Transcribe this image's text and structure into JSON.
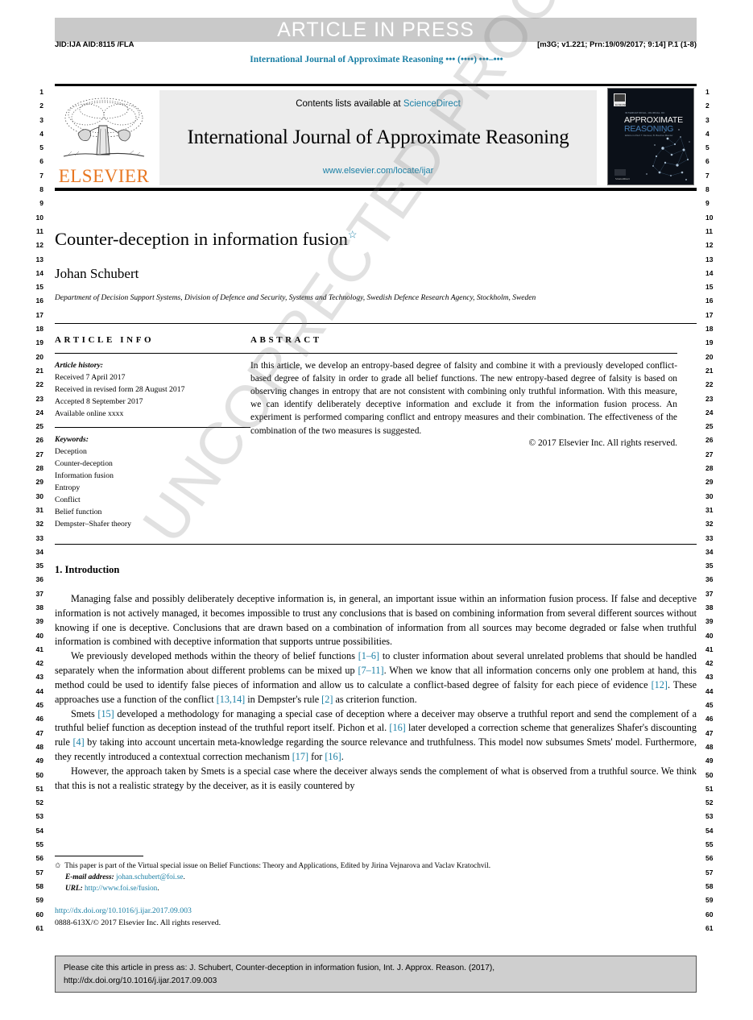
{
  "banner": {
    "label": "ARTICLE IN PRESS"
  },
  "jid": {
    "left": "JID:IJA    AID:8115 /FLA",
    "right": "[m3G; v1.221; Prn:19/09/2017; 9:14] P.1 (1-8)"
  },
  "running_title": "International Journal of Approximate Reasoning ••• (••••) •••–•••",
  "masthead": {
    "contents_prefix": "Contents lists available at ",
    "sciencedirect": "ScienceDirect",
    "journal_name": "International Journal of Approximate Reasoning",
    "journal_url": "www.elsevier.com/locate/ijar",
    "publisher": "ELSEVIER",
    "cover_line1": "APPROXIMATE",
    "cover_line2": "REASONING"
  },
  "watermark": {
    "text": "UNCORRECTED PROOF"
  },
  "article": {
    "title": "Counter-deception in information fusion",
    "title_star": "☆",
    "author": "Johan Schubert",
    "affiliation": "Department of Decision Support Systems, Division of Defence and Security, Systems and Technology, Swedish Defence Research Agency, Stockholm, Sweden"
  },
  "info": {
    "heading": "ARTICLE INFO",
    "history_label": "Article history:",
    "history": [
      "Received 7 April 2017",
      "Received in revised form 28 August 2017",
      "Accepted 8 September 2017",
      "Available online xxxx"
    ],
    "keywords_label": "Keywords:",
    "keywords": [
      "Deception",
      "Counter-deception",
      "Information fusion",
      "Entropy",
      "Conflict",
      "Belief function",
      "Dempster–Shafer theory"
    ]
  },
  "abstract": {
    "heading": "ABSTRACT",
    "text": "In this article, we develop an entropy-based degree of falsity and combine it with a previously developed conflict-based degree of falsity in order to grade all belief functions. The new entropy-based degree of falsity is based on observing changes in entropy that are not consistent with combining only truthful information. With this measure, we can identify deliberately deceptive information and exclude it from the information fusion process. An experiment is performed comparing conflict and entropy measures and their combination. The effectiveness of the combination of the two measures is suggested.",
    "copyright": "© 2017 Elsevier Inc. All rights reserved."
  },
  "body": {
    "section_heading": "1. Introduction",
    "paragraph_1": "Managing false and possibly deliberately deceptive information is, in general, an important issue within an information fusion process. If false and deceptive information is not actively managed, it becomes impossible to trust any conclusions that is based on combining information from several different sources without knowing if one is deceptive. Conclusions that are drawn based on a combination of information from all sources may become degraded or false when truthful information is combined with deceptive information that supports untrue possibilities.",
    "p2_a": "We previously developed methods within the theory of belief functions ",
    "p2_r1": "[1–6]",
    "p2_b": " to cluster information about several unrelated problems that should be handled separately when the information about different problems can be mixed up ",
    "p2_r2": "[7–11]",
    "p2_c": ". When we know that all information concerns only one problem at hand, this method could be used to identify false pieces of information and allow us to calculate a conflict-based degree of falsity for each piece of evidence ",
    "p2_r3": "[12]",
    "p2_d": ". These approaches use a function of the conflict ",
    "p2_r4": "[13,14]",
    "p2_e": " in Dempster's rule ",
    "p2_r5": "[2]",
    "p2_f": " as criterion function.",
    "p3_a": "Smets ",
    "p3_r1": "[15]",
    "p3_b": " developed a methodology for managing a special case of deception where a deceiver may observe a truthful report and send the complement of a truthful belief function as deception instead of the truthful report itself. Pichon et al. ",
    "p3_r2": "[16]",
    "p3_c": " later developed a correction scheme that generalizes Shafer's discounting rule ",
    "p3_r3": "[4]",
    "p3_d": " by taking into account uncertain meta-knowledge regarding the source relevance and truthfulness. This model now subsumes Smets' model. Furthermore, they recently introduced a contextual correction mechanism ",
    "p3_r4": "[17]",
    "p3_e": " for ",
    "p3_r5": "[16]",
    "p3_f": ".",
    "paragraph_4": "However, the approach taken by Smets is a special case where the deceiver always sends the complement of what is observed from a truthful source. We think that this is not a realistic strategy by the deceiver, as it is easily countered by"
  },
  "footnote": {
    "star": "✩",
    "special_issue": "This paper is part of the Virtual special issue on Belief Functions: Theory and Applications, Edited by Jirina Vejnarova and Vaclav Kratochvil.",
    "email_label": "E-mail address:",
    "email": "johan.schubert@foi.se",
    "url_label": "URL:",
    "url": "http://www.foi.se/fusion",
    "doi": "http://dx.doi.org/10.1016/j.ijar.2017.09.003",
    "issn_line": "0888-613X/© 2017 Elsevier Inc. All rights reserved."
  },
  "cite_box": {
    "line1": "Please cite this article in press as: J. Schubert, Counter-deception in information fusion, Int. J. Approx. Reason. (2017),",
    "line2": "http://dx.doi.org/10.1016/j.ijar.2017.09.003"
  },
  "line_numbers": {
    "start": 1,
    "count": 61
  },
  "colors": {
    "accent_link": "#1a7fa5",
    "elsevier_orange": "#E87722",
    "banner_gray": "#c9c9c9",
    "band_gray": "#ececec",
    "cite_gray": "#cfcfcf"
  }
}
